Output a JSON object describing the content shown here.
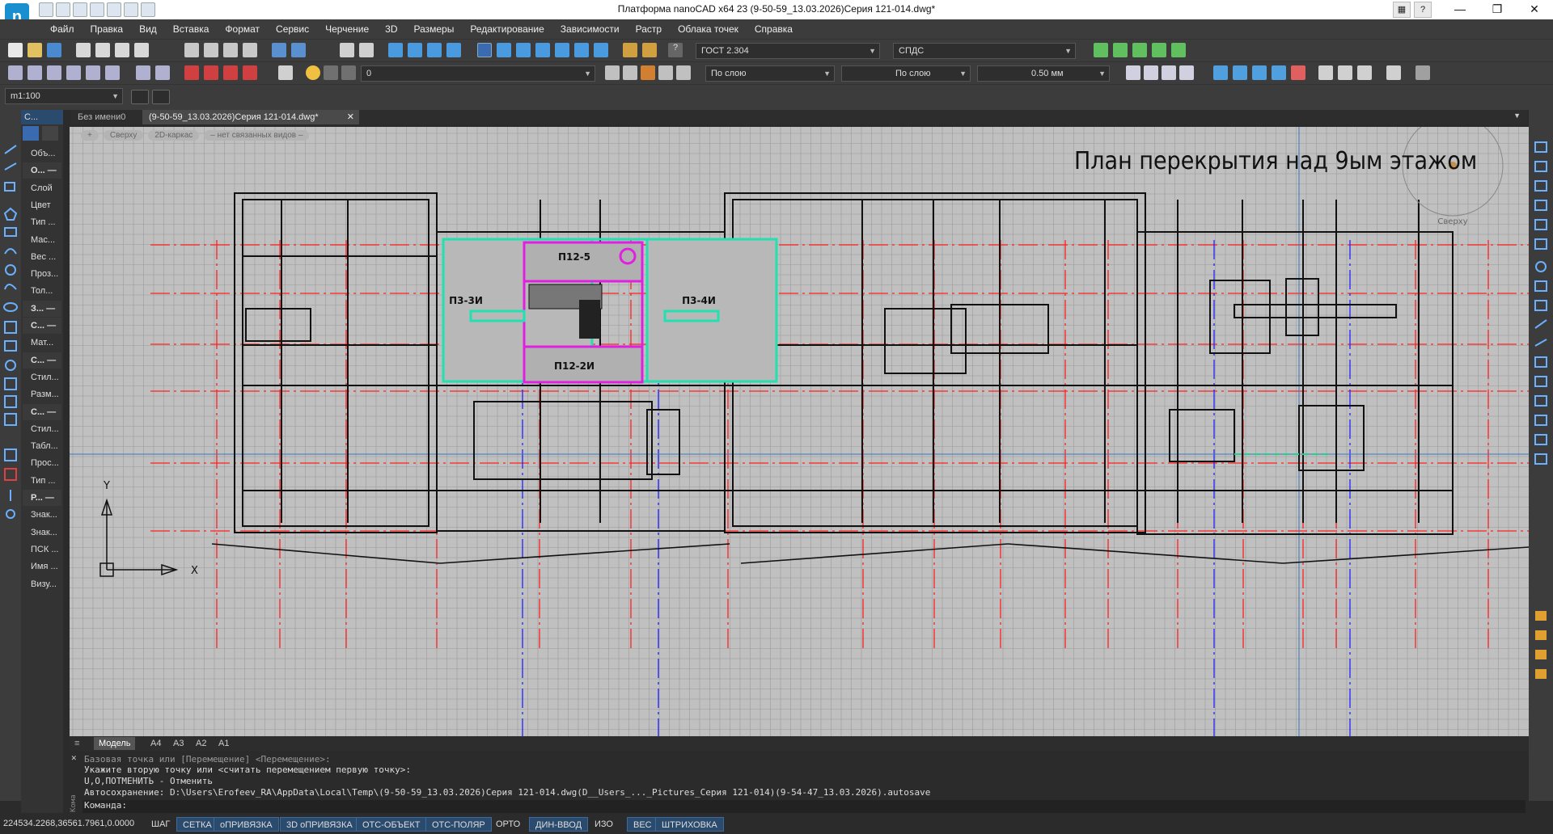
{
  "app": {
    "logo_letter": "n",
    "title": "Платформа nanoCAD x64 23 (9-50-59_13.03.2026)Серия 121-014.dwg*",
    "help_label": "?"
  },
  "menu": [
    "Файл",
    "Правка",
    "Вид",
    "Вставка",
    "Формат",
    "Сервис",
    "Черчение",
    "3D",
    "Размеры",
    "Редактирование",
    "Зависимости",
    "Растр",
    "Облака точек",
    "Справка"
  ],
  "toolbar": {
    "text_style": "ГОСТ 2.304",
    "dim_style": "СПДС",
    "layer": "0",
    "color": "По слою",
    "linetype": "По слою",
    "lineweight": "0.50 мм",
    "scale": "m1:100"
  },
  "props_panel": {
    "header": "С...",
    "rows": [
      "Объ...",
      "О... —",
      "Слой",
      "Цвет",
      "Тип ...",
      "Мас...",
      "Вес ...",
      "Проз...",
      "Тол...",
      "З... —",
      "С... —",
      "Мат...",
      "С... —",
      "Стил...",
      "Разм...",
      "С... —",
      "Стил...",
      "Табл...",
      "Прос...",
      "Тип ...",
      "Р... —",
      "Знак...",
      "Знак...",
      "ПСК ...",
      "Имя ...",
      "Визу..."
    ]
  },
  "doc_tabs": [
    "Без имени0",
    "(9-50-59_13.03.2026)Серия 121-014.dwg*"
  ],
  "view_tags": [
    "+",
    "Сверху",
    "2D-каркас",
    "– нет связанных видов –"
  ],
  "drawing": {
    "title": "План перекрытия над 9ым этажом",
    "labels": [
      "П12-5",
      "П3-3И",
      "П3-4И",
      "П12-2И"
    ],
    "viewcube_label": "Сверху",
    "axis_x": "X",
    "axis_y": "Y"
  },
  "layout_tabs": [
    "Модель",
    "A4",
    "A3",
    "A2",
    "A1"
  ],
  "command": {
    "lines": [
      "Базовая точка или [Перемещение] <Перемещение>:",
      "Укажите вторую точку или <считать перемещением первую точку>:",
      "U,O,ПОТМЕНИТЬ - Отменить",
      "Автосохранение: D:\\Users\\Erofeev_RA\\AppData\\Local\\Temp\\(9-50-59_13.03.2026)Серия 121-014.dwg(D__Users_..._Pictures_Серия 121-014)(9-54-47_13.03.2026).autosave"
    ],
    "prompt": "Команда:",
    "side_label": "Кома"
  },
  "status": {
    "coords": "224534.2268,36561.7961,0.0000",
    "buttons": [
      {
        "label": "ШАГ",
        "on": false
      },
      {
        "label": "СЕТКА",
        "on": true
      },
      {
        "label": "оПРИВЯЗКА",
        "on": true
      },
      {
        "label": "3D оПРИВЯЗКА",
        "on": true
      },
      {
        "label": "ОТС-ОБЪЕКТ",
        "on": true
      },
      {
        "label": "ОТС-ПОЛЯР",
        "on": true
      },
      {
        "label": "ОРТО",
        "on": false
      },
      {
        "label": "ДИН-ВВОД",
        "on": true
      },
      {
        "label": "ИЗО",
        "on": false
      },
      {
        "label": "ВЕС",
        "on": true
      },
      {
        "label": "ШТРИХОВКА",
        "on": true
      }
    ]
  },
  "colors": {
    "axis_red": "#ff2020",
    "axis_blue": "#2020ff",
    "slab_cyan": "#22e0b0",
    "slab_magenta": "#e020e0",
    "accent": "#1a8fd0"
  }
}
